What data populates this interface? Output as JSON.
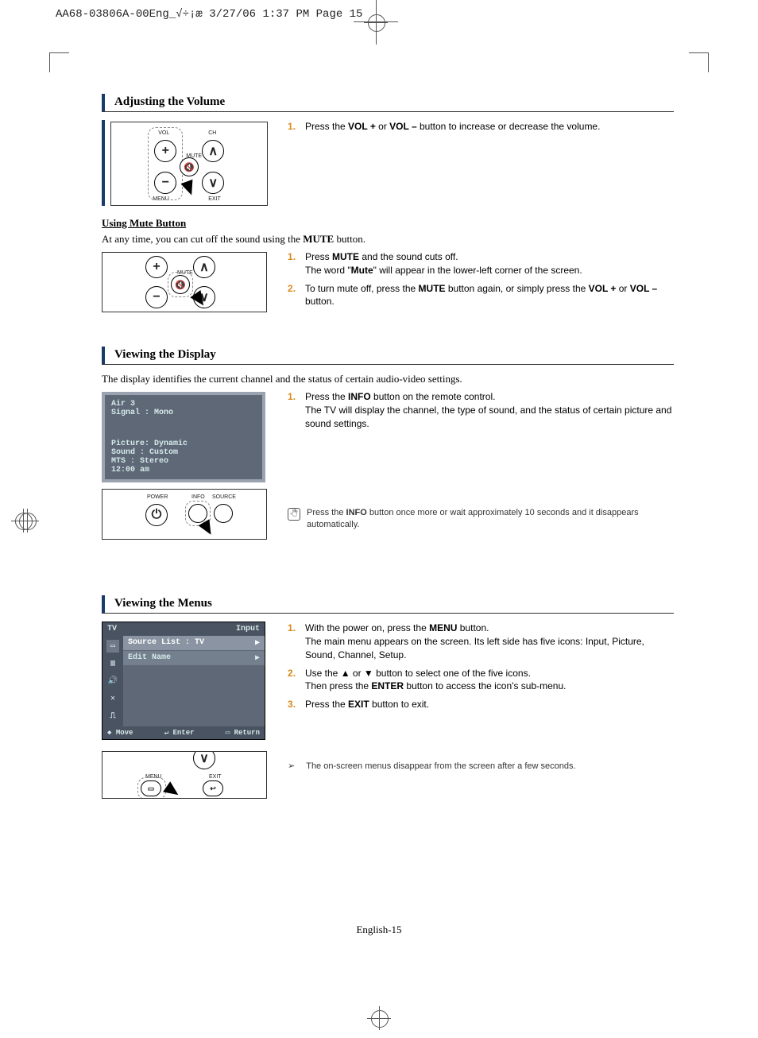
{
  "header": "AA68-03806A-00Eng_√÷¡æ  3/27/06  1:37 PM  Page 15",
  "footer": "English-15",
  "sec1": {
    "heading": "Adjusting the Volume",
    "step1_pre": "Press the ",
    "step1_b1": "VOL +",
    "step1_mid": " or ",
    "step1_b2": "VOL –",
    "step1_post": " button to increase or decrease the volume.",
    "remote": {
      "vol": "VOL",
      "ch": "CH",
      "mute": "MUTE",
      "menu": "MENU",
      "exit": "EXIT"
    },
    "sub_heading": "Using Mute Button",
    "intro_pre": "At any time, you can cut off the sound using the ",
    "intro_b": "MUTE",
    "intro_post": " button.",
    "m1_a": "Press ",
    "m1_b1": "MUTE",
    "m1_c": " and the sound cuts off.",
    "m1_d": "The word \"",
    "m1_b2": "Mute",
    "m1_e": "\" will appear in the lower-left corner of the screen.",
    "m2_a": "To turn mute off, press the ",
    "m2_b1": "MUTE",
    "m2_c": " button again, or simply press the ",
    "m2_b2": "VOL +",
    "m2_d": " or ",
    "m2_b3": "VOL –",
    "m2_e": " button."
  },
  "sec2": {
    "heading": "Viewing the Display",
    "intro": "The display identifies the current channel and the status of certain audio-video settings.",
    "osd_l1": "Air     3",
    "osd_l2": "Signal : Mono",
    "osd_l3": "Picture: Dynamic",
    "osd_l4": "Sound  : Custom",
    "osd_l5": "MTS    : Stereo",
    "osd_l6": "12:00 am",
    "s1_a": "Press the ",
    "s1_b": "INFO",
    "s1_c": " button on the remote control.",
    "s1_d": "The TV will display the channel, the type of sound, and the status of certain picture and sound settings.",
    "note_a": "Press the ",
    "note_b": "INFO",
    "note_c": " button once more or wait approximately 10 seconds and it disappears automatically.",
    "remote": {
      "power": "POWER",
      "info": "INFO",
      "source": "SOURCE"
    }
  },
  "sec3": {
    "heading": "Viewing the Menus",
    "menu": {
      "tl": "TV",
      "tr": "Input",
      "r1_l": "Source List  : TV",
      "r1_r": "▶",
      "r2_l": "Edit Name",
      "r2_r": "▶",
      "f1": "Move",
      "f2": "Enter",
      "f3": "Return",
      "f1_icon": "◆",
      "f2_icon": "↵",
      "f3_icon": "▭"
    },
    "s1_a": "With the power on, press the ",
    "s1_b": "MENU",
    "s1_c": " button.",
    "s1_d": "The main menu appears on the screen. Its left side has five icons: Input, Picture, Sound, Channel, Setup.",
    "s2_a": "Use the ▲ or ▼ button to select one of the five icons.",
    "s2_b": "Then press the ",
    "s2_c": "ENTER",
    "s2_d": " button to access the icon's sub-menu.",
    "s3_a": "Press the ",
    "s3_b": "EXIT",
    "s3_c": " button to exit.",
    "note": "The on-screen menus disappear from the screen after a few seconds.",
    "remote": {
      "menu": "MENU",
      "exit": "EXIT"
    }
  }
}
